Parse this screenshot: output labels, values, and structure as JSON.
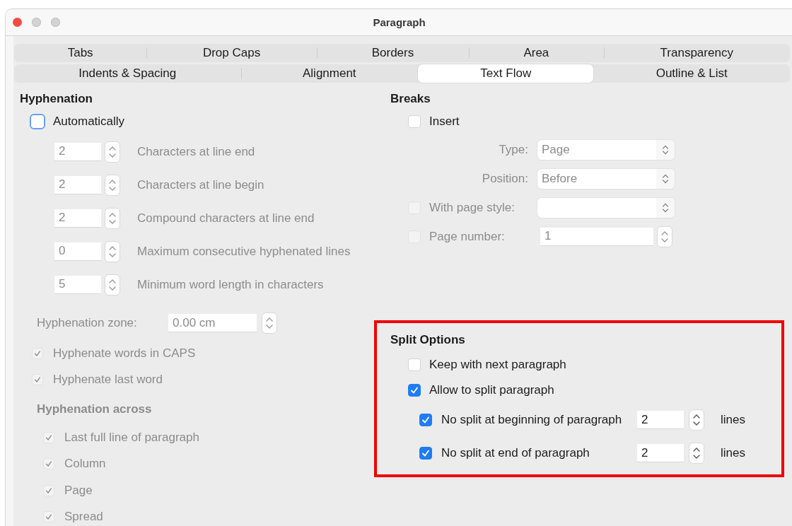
{
  "window": {
    "title": "Paragraph"
  },
  "tab_rows": [
    {
      "tabs": [
        {
          "label": "Tabs",
          "selected": false
        },
        {
          "label": "Drop Caps",
          "selected": false
        },
        {
          "label": "Borders",
          "selected": false
        },
        {
          "label": "Area",
          "selected": false
        },
        {
          "label": "Transparency",
          "selected": false
        }
      ]
    },
    {
      "tabs": [
        {
          "label": "Indents & Spacing",
          "selected": false
        },
        {
          "label": "Alignment",
          "selected": false
        },
        {
          "label": "Text Flow",
          "selected": true
        },
        {
          "label": "Outline & List",
          "selected": false
        }
      ]
    }
  ],
  "hyphenation": {
    "title": "Hyphenation",
    "automatic": {
      "label": "Automatically",
      "checked": false,
      "focused": true
    },
    "spinners": [
      {
        "value": "2",
        "label": "Characters at line end",
        "disabled": true
      },
      {
        "value": "2",
        "label": "Characters at line begin",
        "disabled": true
      },
      {
        "value": "2",
        "label": "Compound characters at line end",
        "disabled": true
      },
      {
        "value": "0",
        "label": "Maximum consecutive hyphenated lines",
        "disabled": true
      },
      {
        "value": "5",
        "label": "Minimum word length in characters",
        "disabled": true
      }
    ],
    "zone": {
      "label": "Hyphenation zone:",
      "value": "0.00 cm",
      "disabled": true
    },
    "options": [
      {
        "label": "Hyphenate words in CAPS",
        "checked": true,
        "disabled": true
      },
      {
        "label": "Hyphenate last word",
        "checked": true,
        "disabled": true
      }
    ],
    "across": {
      "title": "Hyphenation across",
      "disabled": true,
      "options": [
        {
          "label": "Last full line of paragraph",
          "checked": true,
          "disabled": true
        },
        {
          "label": "Column",
          "checked": true,
          "disabled": true
        },
        {
          "label": "Page",
          "checked": true,
          "disabled": true
        },
        {
          "label": "Spread",
          "checked": true,
          "disabled": true
        }
      ]
    }
  },
  "breaks": {
    "title": "Breaks",
    "insert": {
      "label": "Insert",
      "checked": false
    },
    "type": {
      "label": "Type:",
      "value": "Page",
      "disabled": true
    },
    "position": {
      "label": "Position:",
      "value": "Before",
      "disabled": true
    },
    "page_style": {
      "label": "With page style:",
      "checked": false,
      "disabled": true
    },
    "page_number": {
      "label": "Page number:",
      "checked": false,
      "disabled": true,
      "value": "1"
    }
  },
  "split_options": {
    "title": "Split Options",
    "highlighted": true,
    "keep_with_next": {
      "label": "Keep with next paragraph",
      "checked": false
    },
    "allow_split": {
      "label": "Allow to split paragraph",
      "checked": true
    },
    "rules": [
      {
        "label": "No split at beginning of paragraph",
        "checked": true,
        "value": "2",
        "unit": "lines"
      },
      {
        "label": "No split at end of paragraph",
        "checked": true,
        "value": "2",
        "unit": "lines"
      }
    ]
  }
}
